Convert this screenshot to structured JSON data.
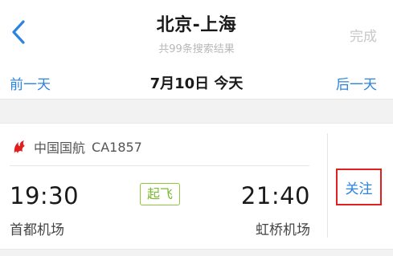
{
  "header": {
    "title": "北京-上海",
    "subtitle": "共99条搜索结果",
    "done_label": "完成",
    "back_icon": "chevron-left-icon"
  },
  "datebar": {
    "prev_label": "前一天",
    "date_label": "7月10日 今天",
    "next_label": "后一天"
  },
  "flight": {
    "airline_logo_icon": "air-china-phoenix-icon",
    "airline_name": "中国国航",
    "flight_no": "CA1857",
    "dep_time": "19:30",
    "arr_time": "21:40",
    "status": "起飞",
    "dep_airport": "首都机场",
    "arr_airport": "虹桥机场",
    "follow_label": "关注"
  },
  "colors": {
    "accent_blue": "#2b84e0",
    "status_green": "#7bb82f",
    "highlight_red": "#e02020",
    "logo_red": "#e02020"
  }
}
